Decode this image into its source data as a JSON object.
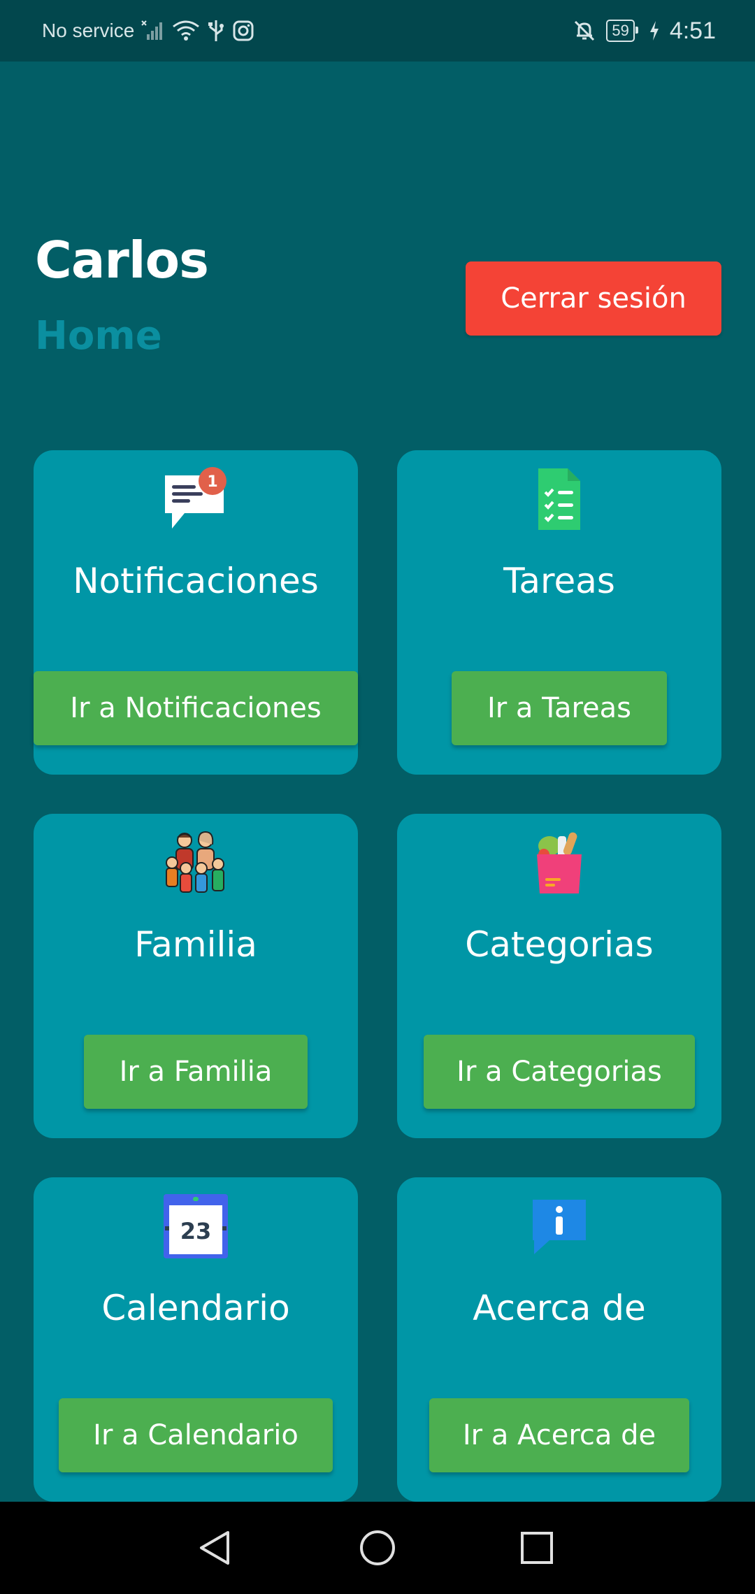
{
  "status_bar": {
    "carrier": "No service",
    "battery": "59",
    "time": "4:51",
    "icons": [
      "no-signal-icon",
      "wifi-icon",
      "usb-icon",
      "instagram-icon",
      "bell-off-icon",
      "battery-icon",
      "charging-icon"
    ]
  },
  "header": {
    "user_name": "Carlos",
    "page_title": "Home",
    "logout_label": "Cerrar sesión"
  },
  "cards": [
    {
      "title": "Notificaciones",
      "button": "Ir a Notificaciones",
      "icon": "notification-chat-icon",
      "badge": "1"
    },
    {
      "title": "Tareas",
      "button": "Ir a Tareas",
      "icon": "checklist-document-icon"
    },
    {
      "title": "Familia",
      "button": "Ir a Familia",
      "icon": "family-icon"
    },
    {
      "title": "Categorias",
      "button": "Ir a Categorias",
      "icon": "grocery-bag-icon"
    },
    {
      "title": "Calendario",
      "button": "Ir a Calendario",
      "icon": "calendar-icon",
      "day": "23"
    },
    {
      "title": "Acerca de",
      "button": "Ir a Acerca de",
      "icon": "info-chat-icon"
    }
  ],
  "nav_bar": {
    "buttons": [
      "back-icon",
      "home-icon",
      "recents-icon"
    ]
  },
  "colors": {
    "background": "#025e66",
    "status_bar": "#02474d",
    "card": "#0096a6",
    "button_green": "#4caf50",
    "logout_red": "#f44336",
    "page_title": "#0b8fa0"
  }
}
